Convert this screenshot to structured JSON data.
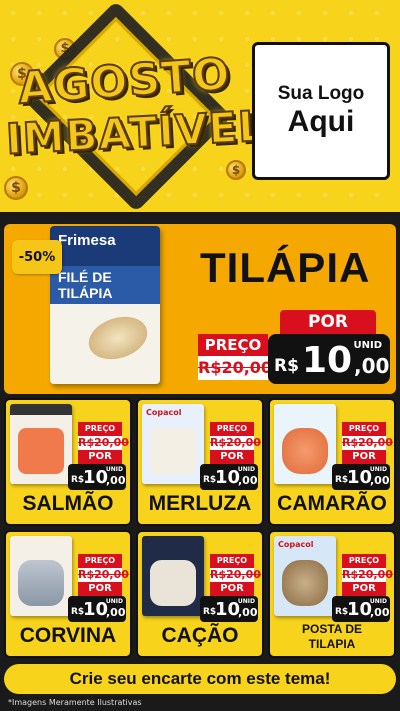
{
  "header": {
    "title_line1": "AGOSTO",
    "title_line2": "IMBATÍVEL",
    "coin_symbol": "$",
    "logo_line1": "Sua Logo",
    "logo_line2": "Aqui"
  },
  "featured": {
    "discount": "-50%",
    "package_brand": "Frimesa",
    "package_text": "FILÉ DE TILÁPIA",
    "name": "TILÁPIA",
    "price_label": "PREÇO",
    "old_price": "R$20,00",
    "por_label": "POR",
    "currency": "R$",
    "new_price_int": "10",
    "new_price_cents": ",00",
    "unit": "UNID"
  },
  "common": {
    "price_label": "PREÇO",
    "por_label": "POR",
    "currency": "R$",
    "unit": "UNID"
  },
  "products": [
    {
      "name": "SALMÃO",
      "old_price": "R$20,00",
      "new_int": "10",
      "new_cents": ",00",
      "img": "salmao",
      "img_label": ""
    },
    {
      "name": "MERLUZA",
      "old_price": "R$20,00",
      "new_int": "10",
      "new_cents": ",00",
      "img": "merluza",
      "img_label": "Copacol"
    },
    {
      "name": "CAMARÃO",
      "old_price": "R$20,00",
      "new_int": "10",
      "new_cents": ",00",
      "img": "camarao",
      "img_label": ""
    },
    {
      "name": "CORVINA",
      "old_price": "R$20,00",
      "new_int": "10",
      "new_cents": ",00",
      "img": "corvina",
      "img_label": ""
    },
    {
      "name": "CAÇÃO",
      "old_price": "R$20,00",
      "new_int": "10",
      "new_cents": ",00",
      "img": "cacao",
      "img_label": ""
    },
    {
      "name": "POSTA DE TILAPIA",
      "old_price": "R$20,00",
      "new_int": "10",
      "new_cents": ",00",
      "img": "tilapia2",
      "img_label": "Copacol"
    }
  ],
  "footer": {
    "cta": "Crie seu encarte com este tema!",
    "disclaimer": "*Imagens Meramente Ilustrativas"
  },
  "colors": {
    "yellow": "#f7d31c",
    "orange": "#f5a800",
    "red": "#d80f1c",
    "black": "#111111"
  }
}
